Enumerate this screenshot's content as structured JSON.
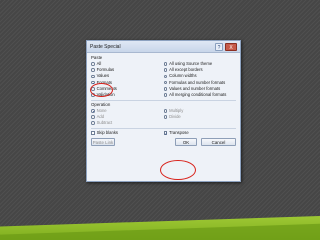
{
  "dialog": {
    "title": "Paste Special",
    "help_icon": "?",
    "close_icon": "X",
    "paste_section": "Paste",
    "paste_left": [
      {
        "label": "All",
        "selected": false
      },
      {
        "label": "Formulas",
        "selected": false
      },
      {
        "label": "Values",
        "selected": false
      },
      {
        "label": "Formats",
        "selected": true
      },
      {
        "label": "Comments",
        "selected": false
      },
      {
        "label": "Validation",
        "selected": false
      }
    ],
    "paste_right": [
      {
        "label": "All using Source theme",
        "selected": false
      },
      {
        "label": "All except borders",
        "selected": false
      },
      {
        "label": "Column widths",
        "selected": false
      },
      {
        "label": "Formulas and number formats",
        "selected": false
      },
      {
        "label": "Values and number formats",
        "selected": false
      },
      {
        "label": "All merging conditional formats",
        "selected": false
      }
    ],
    "operation_section": "Operation",
    "operation_left": [
      {
        "label": "None",
        "selected": true
      },
      {
        "label": "Add",
        "selected": false
      },
      {
        "label": "Subtract",
        "selected": false
      }
    ],
    "operation_right": [
      {
        "label": "Multiply",
        "selected": false
      },
      {
        "label": "Divide",
        "selected": false
      }
    ],
    "skip_blanks": {
      "label": "Skip blanks",
      "checked": false
    },
    "transpose": {
      "label": "Transpose",
      "checked": true
    },
    "paste_link_label": "Paste Link",
    "ok_label": "OK",
    "cancel_label": "Cancel"
  },
  "colors": {
    "highlight_circle": "#d8211a",
    "accent_green": "#8dbf2a"
  }
}
